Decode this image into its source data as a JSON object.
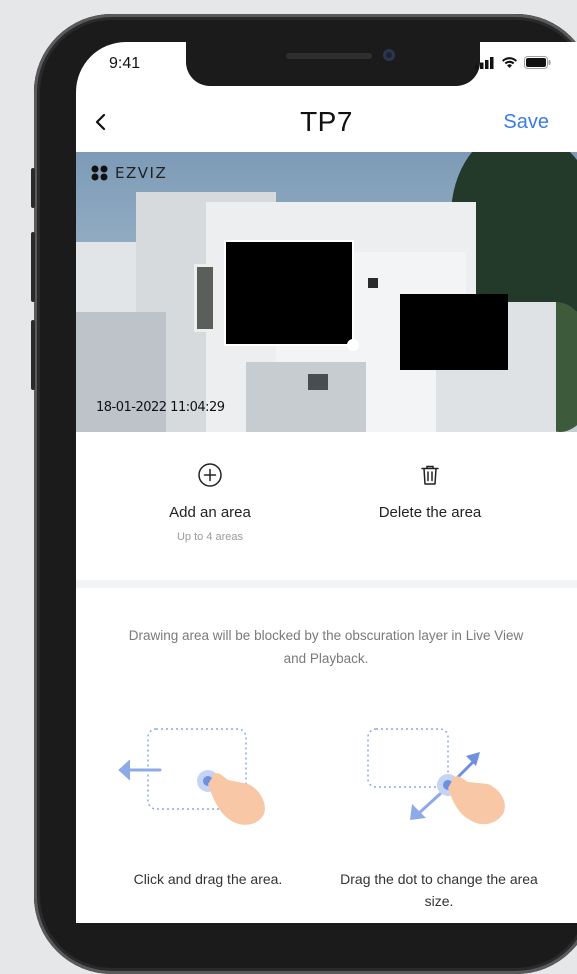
{
  "status_bar": {
    "time": "9:41"
  },
  "nav": {
    "title": "TP7",
    "save_label": "Save"
  },
  "camera": {
    "brand": "EZVIZ",
    "timestamp": "18-01-2022 11:04:29"
  },
  "actions": {
    "add": {
      "label": "Add an area",
      "hint": "Up to 4 areas"
    },
    "delete": {
      "label": "Delete the area"
    }
  },
  "info": {
    "text": "Drawing area will be blocked by the obscuration layer in Live View and Playback."
  },
  "illustrations": {
    "drag": {
      "caption": "Click and drag the area."
    },
    "resize": {
      "caption": "Drag the dot to change the area size."
    }
  },
  "colors": {
    "accent": "#3b7de8",
    "mask": "#000000"
  },
  "icons": [
    "back-chevron-icon",
    "signal-icon",
    "wifi-icon",
    "battery-icon",
    "add-circle-icon",
    "trash-icon",
    "drag-hand-icon",
    "resize-hand-icon"
  ]
}
